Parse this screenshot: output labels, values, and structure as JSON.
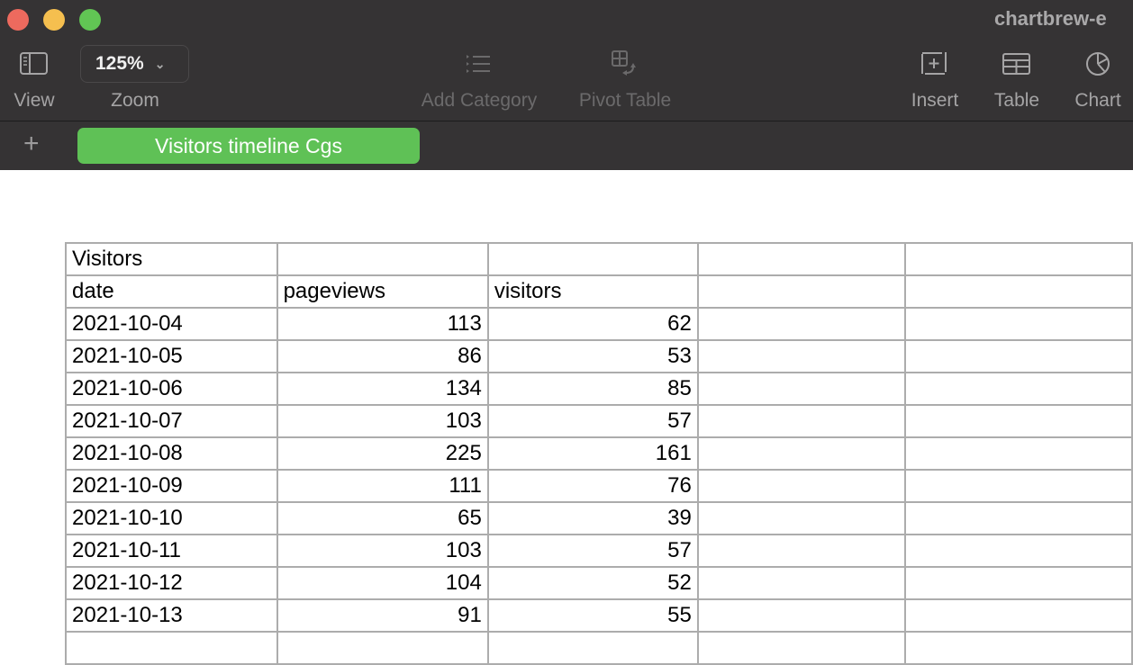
{
  "window": {
    "title": "chartbrew-e",
    "traffic_lights": {
      "close": "#ed6a5e",
      "minimize": "#f5bf4f",
      "maximize": "#61c554"
    }
  },
  "toolbar": {
    "view_label": "View",
    "view_icon": "sidebar-icon",
    "zoom_value": "125%",
    "zoom_label": "Zoom",
    "add_category_label": "Add Category",
    "pivot_table_label": "Pivot Table",
    "insert_label": "Insert",
    "table_label": "Table",
    "chart_label": "Chart"
  },
  "tabs": {
    "add_symbol": "+",
    "active_sheet": "Visitors timeline  Cgs",
    "active_color": "#5fc156"
  },
  "sheet": {
    "title": "Visitors",
    "columns": [
      "date",
      "pageviews",
      "visitors"
    ],
    "rows": [
      {
        "date": "2021-10-04",
        "pageviews": "113",
        "visitors": "62"
      },
      {
        "date": "2021-10-05",
        "pageviews": "86",
        "visitors": "53"
      },
      {
        "date": "2021-10-06",
        "pageviews": "134",
        "visitors": "85"
      },
      {
        "date": "2021-10-07",
        "pageviews": "103",
        "visitors": "57"
      },
      {
        "date": "2021-10-08",
        "pageviews": "225",
        "visitors": "161"
      },
      {
        "date": "2021-10-09",
        "pageviews": "111",
        "visitors": "76"
      },
      {
        "date": "2021-10-10",
        "pageviews": "65",
        "visitors": "39"
      },
      {
        "date": "2021-10-11",
        "pageviews": "103",
        "visitors": "57"
      },
      {
        "date": "2021-10-12",
        "pageviews": "104",
        "visitors": "52"
      },
      {
        "date": "2021-10-13",
        "pageviews": "91",
        "visitors": "55"
      }
    ]
  }
}
